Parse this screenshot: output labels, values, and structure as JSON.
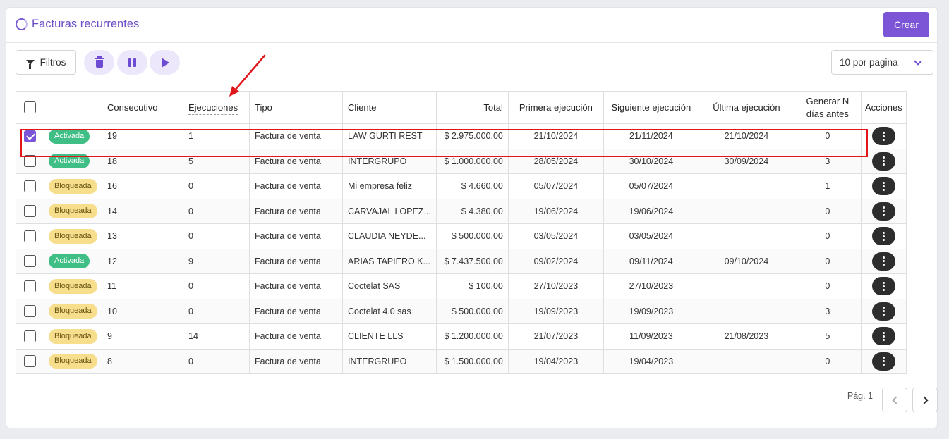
{
  "header": {
    "title": "Facturas recurrentes",
    "create_label": "Crear"
  },
  "toolbar": {
    "filters_label": "Filtros",
    "per_page": "10 por pagina"
  },
  "table": {
    "columns": {
      "consecutivo": "Consecutivo",
      "ejecuciones": "Ejecuciones",
      "tipo": "Tipo",
      "cliente": "Cliente",
      "total": "Total",
      "primera": "Primera ejecución",
      "siguiente": "Siguiente ejecución",
      "ultima": "Última ejecución",
      "generar": "Generar N días antes",
      "acciones": "Acciones"
    },
    "rows": [
      {
        "checked": true,
        "status": "Activada",
        "consecutivo": "19",
        "ejecuciones": "1",
        "tipo": "Factura de venta",
        "cliente": "LAW GURTI REST",
        "total": "$ 2.975.000,00",
        "primera": "21/10/2024",
        "siguiente": "21/11/2024",
        "ultima": "21/10/2024",
        "generar": "0"
      },
      {
        "checked": false,
        "status": "Activada",
        "consecutivo": "18",
        "ejecuciones": "5",
        "tipo": "Factura de venta",
        "cliente": "INTERGRUPO",
        "total": "$ 1.000.000,00",
        "primera": "28/05/2024",
        "siguiente": "30/10/2024",
        "ultima": "30/09/2024",
        "generar": "3"
      },
      {
        "checked": false,
        "status": "Bloqueada",
        "consecutivo": "16",
        "ejecuciones": "0",
        "tipo": "Factura de venta",
        "cliente": "Mi empresa feliz",
        "total": "$ 4.660,00",
        "primera": "05/07/2024",
        "siguiente": "05/07/2024",
        "ultima": "",
        "generar": "1"
      },
      {
        "checked": false,
        "status": "Bloqueada",
        "consecutivo": "14",
        "ejecuciones": "0",
        "tipo": "Factura de venta",
        "cliente": "CARVAJAL LOPEZ...",
        "total": "$ 4.380,00",
        "primera": "19/06/2024",
        "siguiente": "19/06/2024",
        "ultima": "",
        "generar": "0"
      },
      {
        "checked": false,
        "status": "Bloqueada",
        "consecutivo": "13",
        "ejecuciones": "0",
        "tipo": "Factura de venta",
        "cliente": "CLAUDIA NEYDE...",
        "total": "$ 500.000,00",
        "primera": "03/05/2024",
        "siguiente": "03/05/2024",
        "ultima": "",
        "generar": "0"
      },
      {
        "checked": false,
        "status": "Activada",
        "consecutivo": "12",
        "ejecuciones": "9",
        "tipo": "Factura de venta",
        "cliente": "ARIAS TAPIERO K...",
        "total": "$ 7.437.500,00",
        "primera": "09/02/2024",
        "siguiente": "09/11/2024",
        "ultima": "09/10/2024",
        "generar": "0"
      },
      {
        "checked": false,
        "status": "Bloqueada",
        "consecutivo": "11",
        "ejecuciones": "0",
        "tipo": "Factura de venta",
        "cliente": "Coctelat SAS",
        "total": "$ 100,00",
        "primera": "27/10/2023",
        "siguiente": "27/10/2023",
        "ultima": "",
        "generar": "0"
      },
      {
        "checked": false,
        "status": "Bloqueada",
        "consecutivo": "10",
        "ejecuciones": "0",
        "tipo": "Factura de venta",
        "cliente": "Coctelat 4.0 sas",
        "total": "$ 500.000,00",
        "primera": "19/09/2023",
        "siguiente": "19/09/2023",
        "ultima": "",
        "generar": "3"
      },
      {
        "checked": false,
        "status": "Bloqueada",
        "consecutivo": "9",
        "ejecuciones": "14",
        "tipo": "Factura de venta",
        "cliente": "CLIENTE LLS",
        "total": "$ 1.200.000,00",
        "primera": "21/07/2023",
        "siguiente": "11/09/2023",
        "ultima": "21/08/2023",
        "generar": "5"
      },
      {
        "checked": false,
        "status": "Bloqueada",
        "consecutivo": "8",
        "ejecuciones": "0",
        "tipo": "Factura de venta",
        "cliente": "INTERGRUPO",
        "total": "$ 1.500.000,00",
        "primera": "19/04/2023",
        "siguiente": "19/04/2023",
        "ultima": "",
        "generar": "0"
      }
    ]
  },
  "pagination": {
    "label": "Pág. 1"
  },
  "colors": {
    "accent": "#7b55d6",
    "active": "#3fbf85",
    "blocked": "#f7de8c",
    "annotation": "#e0161b"
  },
  "icons": [
    "loading-ring-icon",
    "filter-icon",
    "trash-icon",
    "pause-icon",
    "play-icon",
    "chevron-down-icon",
    "kebab-icon",
    "chevron-left-icon",
    "chevron-right-icon"
  ]
}
